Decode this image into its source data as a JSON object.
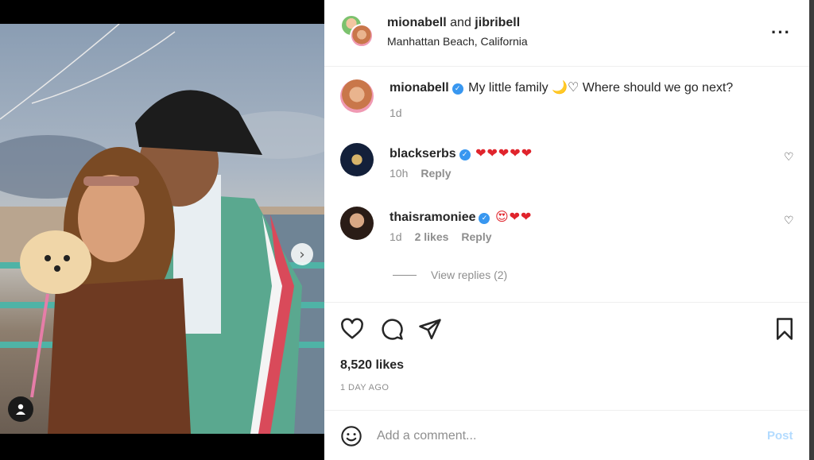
{
  "post": {
    "author": "mionabell",
    "collaborator": "jibribell",
    "joiner": "and",
    "location": "Manhattan Beach, California",
    "caption_user": "mionabell",
    "caption_text": "My little family 🌙♡ Where should we go next?",
    "caption_time": "1d"
  },
  "comments": [
    {
      "user": "blackserbs",
      "text": "❤❤❤❤❤",
      "time": "10h",
      "likes": "",
      "reply": "Reply"
    },
    {
      "user": "thaisramoniee",
      "text": "😍❤❤",
      "time": "1d",
      "likes": "2 likes",
      "reply": "Reply"
    }
  ],
  "view_replies": "View replies (2)",
  "likes_count": "8,520 likes",
  "time_ago": "1 DAY AGO",
  "add_comment": {
    "placeholder": "Add a comment...",
    "post_label": "Post"
  },
  "colors": {
    "verified": "#3897f0",
    "post_disabled": "#b3dbff",
    "secondary_text": "#8e8e8e",
    "heart_red": "#e0242c"
  },
  "icons": {
    "more": "more-horizontal-icon",
    "like": "heart-outline-icon",
    "comment": "comment-bubble-icon",
    "share": "paper-plane-icon",
    "save": "bookmark-icon",
    "emoji": "emoji-smile-icon",
    "next": "chevron-right-icon",
    "tag": "user-tag-icon"
  }
}
